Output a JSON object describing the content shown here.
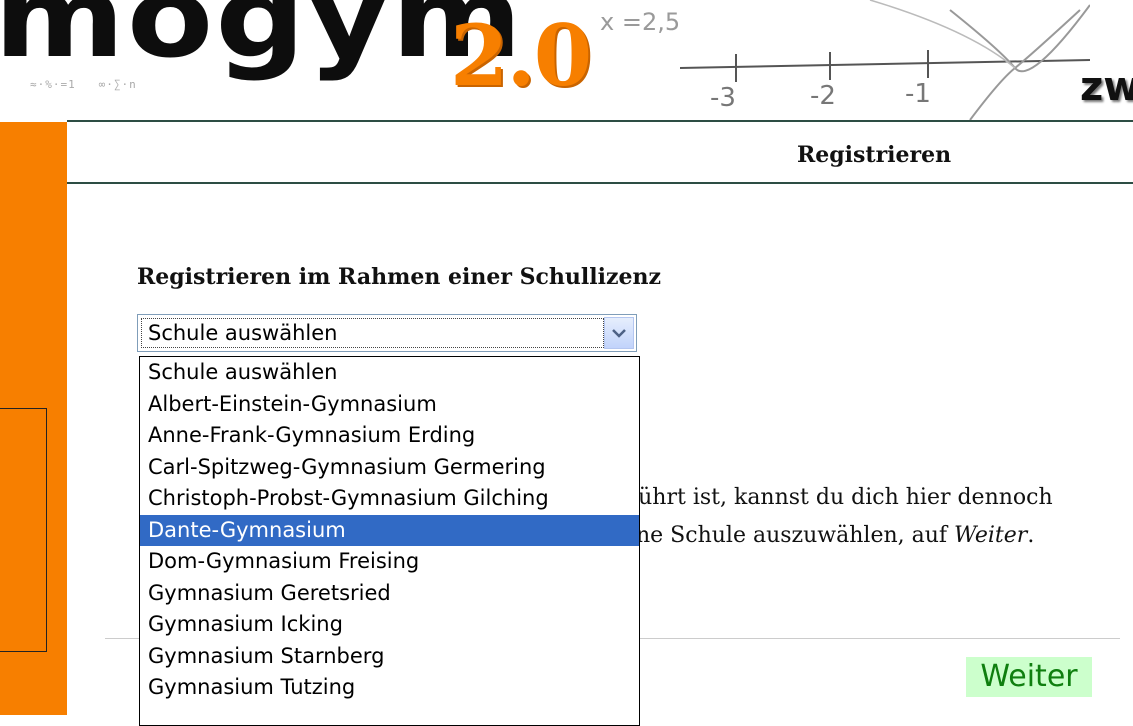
{
  "banner": {
    "logo_text": "mogym",
    "logo_version": "2.0",
    "formula": "x =2,5",
    "axis_labels": [
      "-3",
      "-2",
      "-1"
    ],
    "corner_text": "zw"
  },
  "header": {
    "title": "Registrieren"
  },
  "main": {
    "section_title": "Registrieren im Rahmen einer Schullizenz",
    "select": {
      "value": "Schule auswählen",
      "options": [
        "Schule auswählen",
        "Albert-Einstein-Gymnasium",
        "Anne-Frank-Gymnasium Erding",
        "Carl-Spitzweg-Gymnasium Germering",
        "Christoph-Probst-Gymnasium Gilching",
        "Dante-Gymnasium",
        "Dom-Gymnasium Freising",
        "Gymnasium Geretsried",
        "Gymnasium Icking",
        "Gymnasium Starnberg",
        "Gymnasium Tutzing"
      ],
      "highlighted": "Dante-Gymnasium"
    },
    "text_line1": "führt ist, kannst du dich hier dennoch",
    "text_line2_a": "ne Schule auszuwählen, auf ",
    "text_line2_em": "Weiter",
    "text_line2_b": "."
  },
  "actions": {
    "next_label": "Weiter"
  },
  "colors": {
    "brand_orange": "#f77f00",
    "rule": "#2d4d44",
    "selection": "#316ac5",
    "button_bg": "#ccffcc",
    "button_text": "#0f7f0f"
  }
}
